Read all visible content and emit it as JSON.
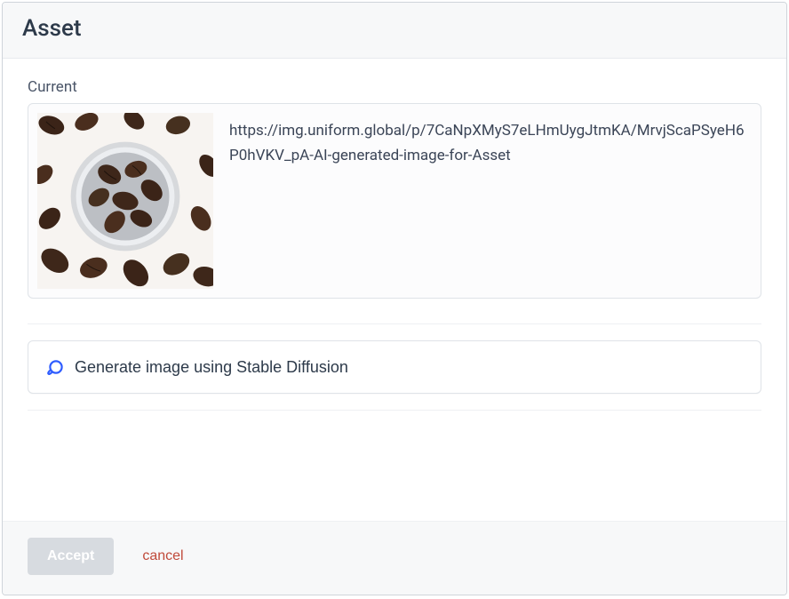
{
  "header": {
    "title": "Asset"
  },
  "current": {
    "label": "Current",
    "url": "https://img.uniform.global/p/7CaNpXMyS7eLHmUygJtmKA/MrvjScaPSyeH6P0hVKV_pA-AI-generated-image-for-Asset",
    "thumb_alt": "coffee-beans"
  },
  "generate": {
    "label": "Generate image using Stable Diffusion"
  },
  "footer": {
    "accept": "Accept",
    "cancel": "cancel"
  }
}
